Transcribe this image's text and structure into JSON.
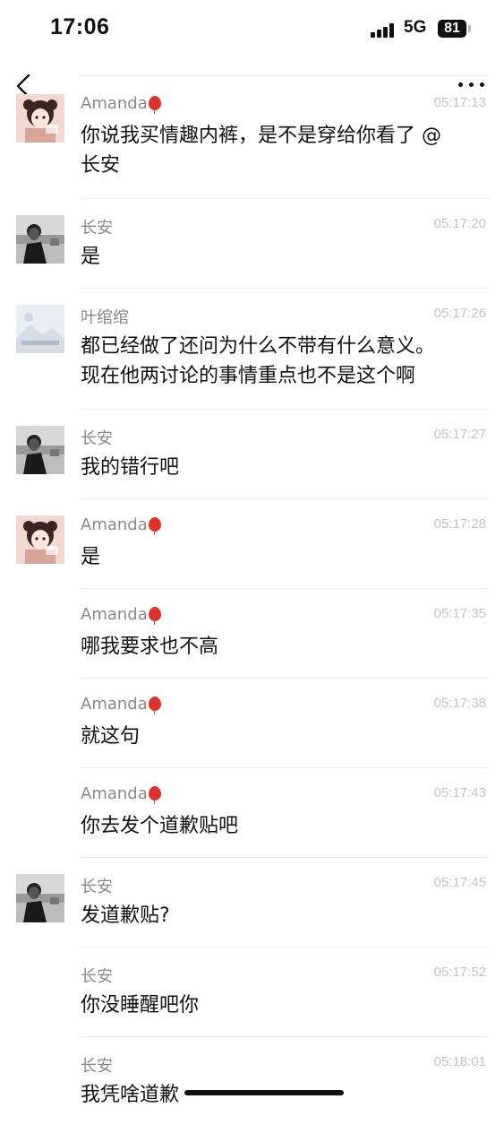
{
  "status": {
    "time": "17:06",
    "network": "5G",
    "battery": "81"
  },
  "icons": {
    "back": "chevron-left-icon",
    "more": "more-dots-icon"
  },
  "messages": [
    {
      "name": "Amanda",
      "badge": "balloon",
      "time": "05:17:13",
      "text_lines": [
        "你说我买情趣内裤，是不是穿给你看了 @",
        "长安"
      ],
      "avatar": "amanda"
    },
    {
      "name": "长安",
      "time": "05:17:20",
      "text_lines": [
        "是"
      ],
      "avatar": "changan"
    },
    {
      "name": "叶绾绾",
      "time": "05:17:26",
      "text_lines": [
        "都已经做了还问为什么不带有什么意义。",
        "现在他两讨论的事情重点也不是这个啊"
      ],
      "avatar": "yewanwan"
    },
    {
      "name": "长安",
      "time": "05:17:27",
      "text_lines": [
        "我的错行吧"
      ],
      "avatar": "changan"
    },
    {
      "name": "Amanda",
      "badge": "balloon",
      "time": "05:17:28",
      "text_lines": [
        "是"
      ],
      "avatar": "amanda"
    },
    {
      "name": "Amanda",
      "badge": "balloon",
      "time": "05:17:35",
      "text_lines": [
        "哪我要求也不高"
      ],
      "avatar": ""
    },
    {
      "name": "Amanda",
      "badge": "balloon",
      "time": "05:17:38",
      "text_lines": [
        "就这句"
      ],
      "avatar": ""
    },
    {
      "name": "Amanda",
      "badge": "balloon",
      "time": "05:17:43",
      "text_lines": [
        "你去发个道歉贴吧"
      ],
      "avatar": ""
    },
    {
      "name": "长安",
      "time": "05:17:45",
      "text_lines": [
        "发道歉贴?"
      ],
      "avatar": "changan"
    },
    {
      "name": "长安",
      "time": "05:17:52",
      "text_lines": [
        "你没睡醒吧你"
      ],
      "avatar": ""
    },
    {
      "name": "长安",
      "time": "05:18:01",
      "text_lines": [
        "我凭啥道歉"
      ],
      "avatar": ""
    }
  ]
}
